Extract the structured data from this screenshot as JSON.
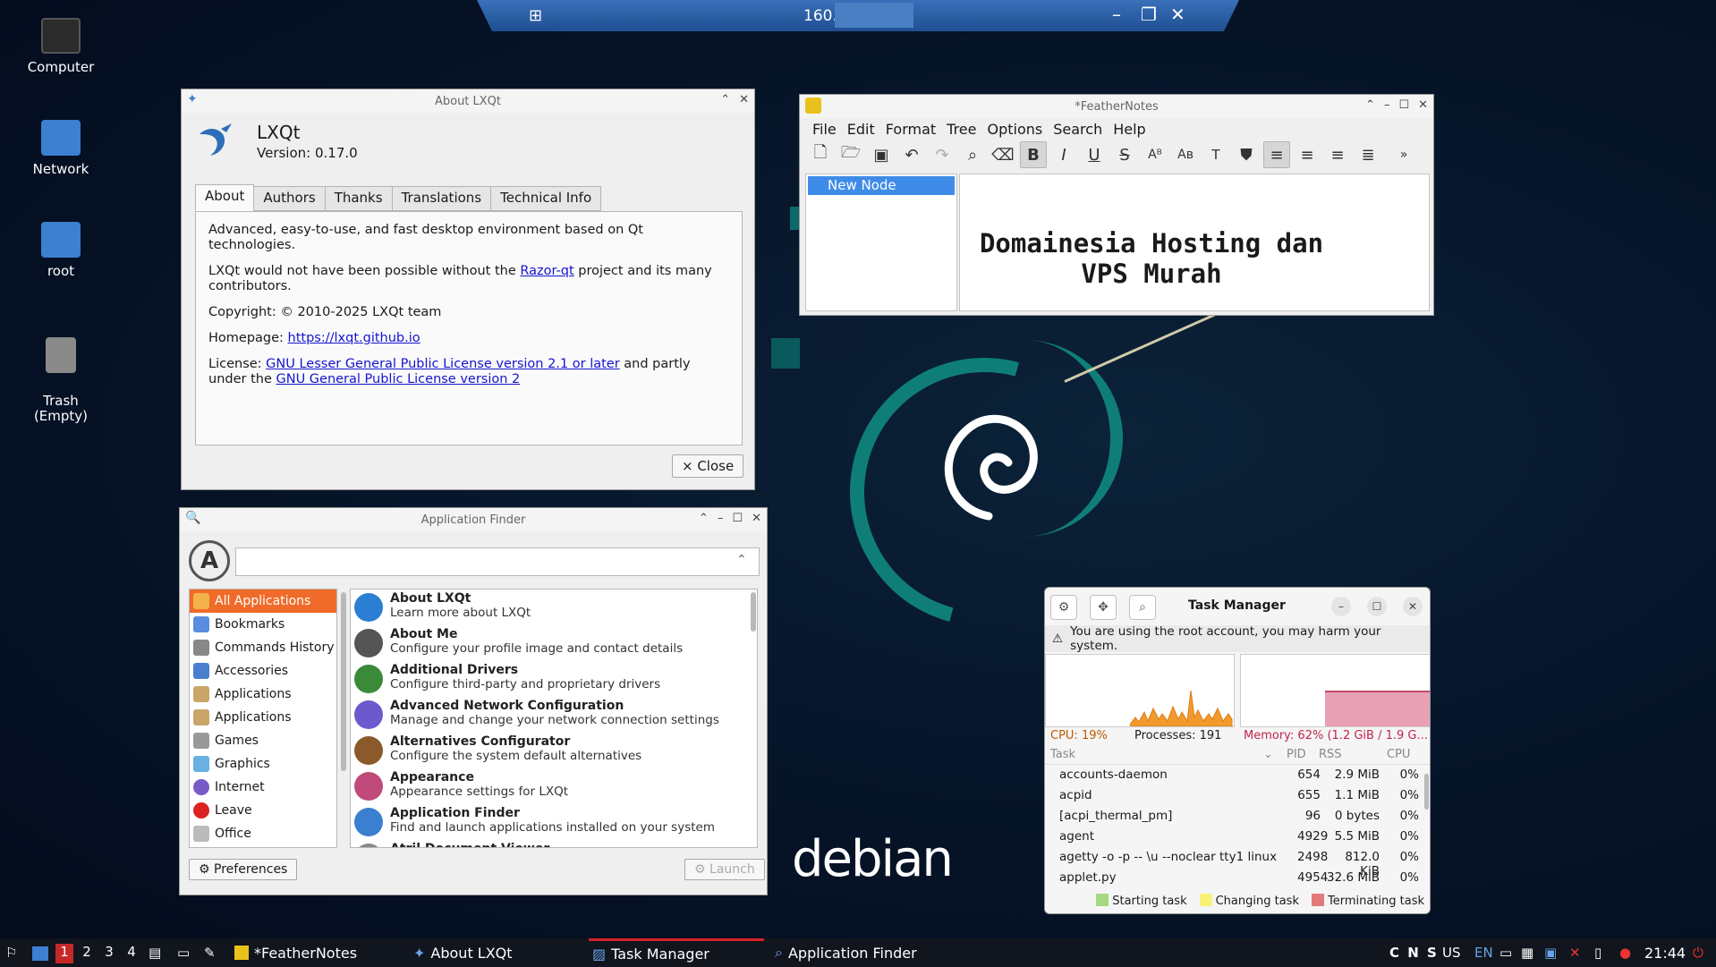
{
  "remote_bar": {
    "ip": "160.",
    "pin_icon": "pin-icon"
  },
  "desktop": {
    "icons": [
      {
        "label": "Computer"
      },
      {
        "label": "Network"
      },
      {
        "label": "root"
      },
      {
        "label": "Trash\n(Empty)"
      }
    ],
    "wallpaper_brand": "debian"
  },
  "about_window": {
    "title": "About LXQt",
    "app_name": "LXQt",
    "version": "Version: 0.17.0",
    "tabs": [
      "About",
      "Authors",
      "Thanks",
      "Translations",
      "Technical Info"
    ],
    "p1": "Advanced, easy-to-use, and fast desktop environment based on Qt technologies.",
    "p2_pre": "LXQt would not have been possible without the ",
    "p2_link": "Razor-qt",
    "p2_post": " project and its many contributors.",
    "copyright": "Copyright: © 2010-2025 LXQt team",
    "homepage_label": "Homepage: ",
    "homepage_link": "https://lxqt.github.io",
    "license_label": "License: ",
    "license_link1": "GNU Lesser General Public License version 2.1 or later",
    "license_mid": " and partly under the ",
    "license_link2": "GNU General Public License version 2",
    "close_button": "× Close"
  },
  "feathernotes": {
    "title": "*FeatherNotes",
    "menu": [
      "File",
      "Edit",
      "Format",
      "Tree",
      "Options",
      "Search",
      "Help"
    ],
    "tree_node": "New Node",
    "editor_line1": "Domainesia Hosting dan",
    "editor_line2": "VPS Murah"
  },
  "app_finder": {
    "title": "Application Finder",
    "search_placeholder": "",
    "categories": [
      "All Applications",
      "Bookmarks",
      "Commands History",
      "Accessories",
      "Applications",
      "Applications",
      "Games",
      "Graphics",
      "Internet",
      "Leave",
      "Office"
    ],
    "apps": [
      {
        "name": "About LXQt",
        "desc": "Learn more about LXQt",
        "color": "#2a7fd4"
      },
      {
        "name": "About Me",
        "desc": "Configure your profile image and contact details",
        "color": "#555555"
      },
      {
        "name": "Additional Drivers",
        "desc": "Configure third-party and proprietary drivers",
        "color": "#3a8a3a"
      },
      {
        "name": "Advanced Network Configuration",
        "desc": "Manage and change your network connection settings",
        "color": "#6a5acd"
      },
      {
        "name": "Alternatives Configurator",
        "desc": "Configure the system default alternatives",
        "color": "#8b5a2b"
      },
      {
        "name": "Appearance",
        "desc": "Appearance settings for LXQt",
        "color": "#c04a7a"
      },
      {
        "name": "Application Finder",
        "desc": "Find and launch applications installed on your system",
        "color": "#3a7fd0"
      },
      {
        "name": "Atril Document Viewer",
        "desc": "",
        "color": "#888888"
      }
    ],
    "preferences_button": "Preferences",
    "launch_button": "Launch"
  },
  "task_manager": {
    "title": "Task Manager",
    "warning": "You are using the root account, you may harm your system.",
    "cpu": "CPU: 19%",
    "processes": "Processes: 191",
    "memory": "Memory: 62% (1.2 GiB / 1.9 G...",
    "columns": [
      "Task",
      "PID",
      "RSS",
      "CPU"
    ],
    "rows": [
      {
        "task": "accounts-daemon",
        "pid": "654",
        "rss": "2.9 MiB",
        "cpu": "0%"
      },
      {
        "task": "acpid",
        "pid": "655",
        "rss": "1.1 MiB",
        "cpu": "0%"
      },
      {
        "task": "[acpi_thermal_pm]",
        "pid": "96",
        "rss": "0 bytes",
        "cpu": "0%"
      },
      {
        "task": "agent",
        "pid": "4929",
        "rss": "5.5 MiB",
        "cpu": "0%"
      },
      {
        "task": "agetty -o -p -- \\u --noclear tty1 linux",
        "pid": "2498",
        "rss": "812.0 KiB",
        "cpu": "0%"
      },
      {
        "task": "applet.py",
        "pid": "4954",
        "rss": "32.6 MiB",
        "cpu": "0%"
      }
    ],
    "legend": [
      "Starting task",
      "Changing task",
      "Terminating task"
    ],
    "legend_colors": [
      "#a5d883",
      "#f7f17a",
      "#e37a7a"
    ],
    "memory_level": 0.62
  },
  "taskbar": {
    "workspaces": [
      "1",
      "2",
      "3",
      "4"
    ],
    "windows": [
      "*FeatherNotes",
      "About LXQt",
      "Task Manager",
      "Application Finder"
    ],
    "tray_text": "C N S",
    "layout": "US",
    "lang": "EN",
    "clock": "21:44"
  }
}
